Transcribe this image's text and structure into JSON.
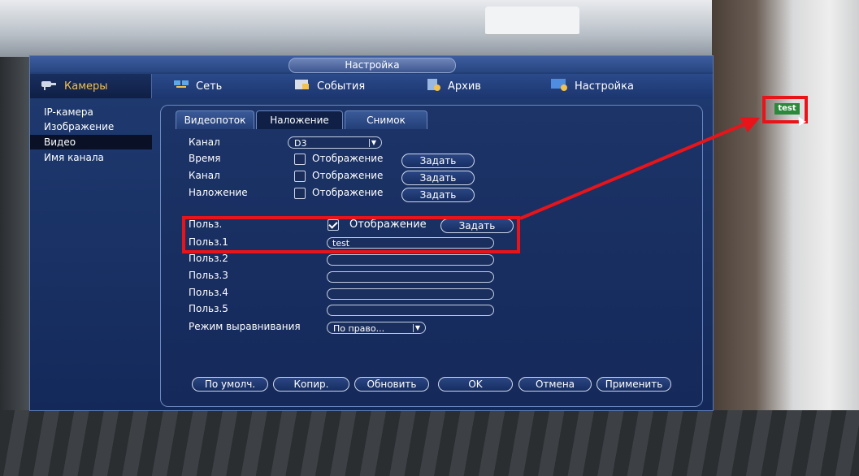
{
  "window": {
    "title": "Настройка"
  },
  "topnav": {
    "cameras": "Камеры",
    "network": "Сеть",
    "events": "События",
    "archive": "Архив",
    "settings": "Настройка"
  },
  "sidebar": {
    "items": [
      {
        "label": "IP-камера"
      },
      {
        "label": "Изображение"
      },
      {
        "label": "Видео"
      },
      {
        "label": "Имя канала"
      }
    ]
  },
  "tabs": {
    "stream": "Видеопоток",
    "overlay": "Наложение",
    "snapshot": "Снимок"
  },
  "form": {
    "channel_label": "Канал",
    "channel_value": "D3",
    "rows": [
      {
        "label": "Время",
        "check_label": "Отображение",
        "button": "Задать",
        "checked": false
      },
      {
        "label": "Канал",
        "check_label": "Отображение",
        "button": "Задать",
        "checked": false
      },
      {
        "label": "Наложение",
        "check_label": "Отображение",
        "button": "Задать",
        "checked": false
      }
    ],
    "custom_label": "Польз.",
    "custom_check_label": "Отображение",
    "custom_button": "Задать",
    "custom_checked": true,
    "user_fields": [
      {
        "label": "Польз.1",
        "value": "test"
      },
      {
        "label": "Польз.2",
        "value": ""
      },
      {
        "label": "Польз.3",
        "value": ""
      },
      {
        "label": "Польз.4",
        "value": ""
      },
      {
        "label": "Польз.5",
        "value": ""
      }
    ],
    "align_label": "Режим выравнивания",
    "align_value": "По право..."
  },
  "buttons": {
    "default": "По умолч.",
    "copy": "Копир.",
    "refresh": "Обновить",
    "ok": "OK",
    "cancel": "Отмена",
    "apply": "Применить"
  },
  "preview": {
    "overlay_text": "test"
  },
  "colors": {
    "highlight": "#e8141a",
    "overlay_bg": "#2a8a3a"
  }
}
